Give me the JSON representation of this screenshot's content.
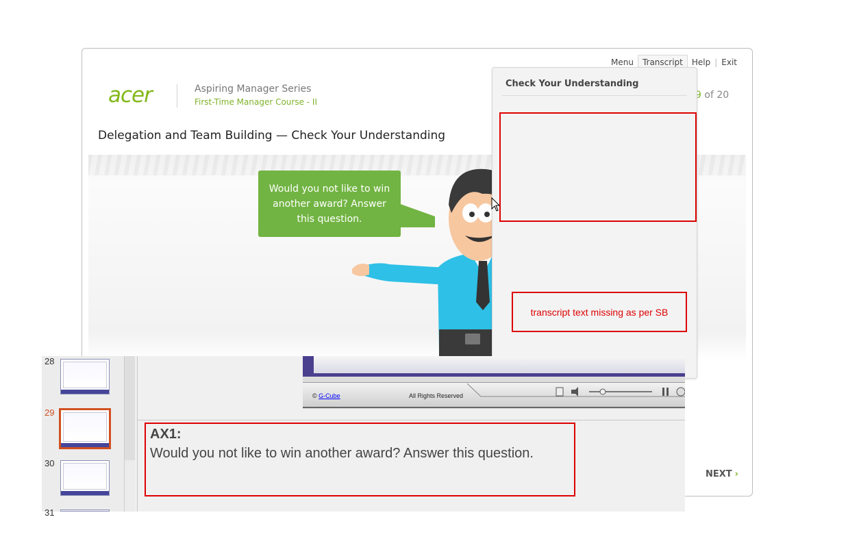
{
  "nav": {
    "menu": "Menu",
    "transcript": "Transcript",
    "help": "Help",
    "exit": "Exit"
  },
  "brand": {
    "logo": "acer",
    "series": "Aspiring Manager Series",
    "course": "First-Time Manager Course - II"
  },
  "page": {
    "current": "9",
    "total_text": " of 20"
  },
  "slide": {
    "title": "Delegation and Team Building — Check Your Understanding"
  },
  "bubble": {
    "text": "Would you not like to win another award? Answer this question."
  },
  "next": {
    "label": "NEXT"
  },
  "transcript_panel": {
    "title": "Check Your Understanding",
    "missing_note": "transcript  text missing as per SB"
  },
  "thumbnails": [
    {
      "number": "28"
    },
    {
      "number": "29",
      "selected": true
    },
    {
      "number": "30"
    },
    {
      "number": "31"
    }
  ],
  "player": {
    "copyright_symbol": "©",
    "copyright_link": "G-Cube",
    "rights": "All Rights Reserved"
  },
  "notes": {
    "label": "AX1:",
    "text": "Would you not like to win another award? Answer this question."
  },
  "colors": {
    "accent_green": "#72b443",
    "annotation_red": "#dd0000",
    "selected_thumb": "#d05020"
  }
}
